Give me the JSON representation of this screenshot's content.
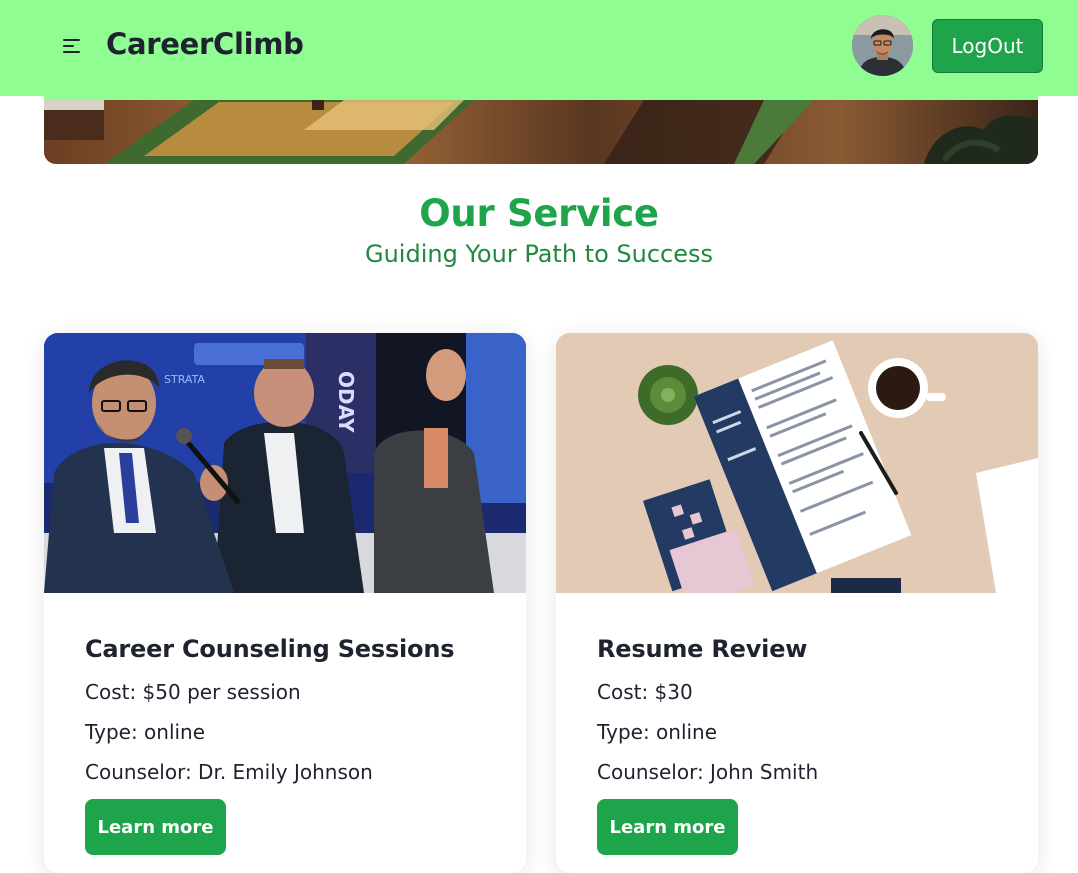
{
  "navbar": {
    "brand": "CareerClimb",
    "menu_icon": "hamburger-menu-icon",
    "avatar_icon": "user-avatar",
    "logout_label": "LogOut",
    "colors": {
      "background": "#8ffd92",
      "button": "#1ea44b"
    }
  },
  "services": {
    "title": "Our Service",
    "subtitle": "Guiding Your Path to Success",
    "cards": [
      {
        "image": "conference-panel-photo",
        "title": "Career Counseling Sessions",
        "cost": "Cost: $50 per session",
        "type": "Type: online",
        "counselor": "Counselor: Dr. Emily Johnson",
        "button_label": "Learn more"
      },
      {
        "image": "resume-on-desk-photo",
        "title": "Resume Review",
        "cost": "Cost: $30",
        "type": "Type: online",
        "counselor": "Counselor: John Smith",
        "button_label": "Learn more"
      }
    ]
  }
}
